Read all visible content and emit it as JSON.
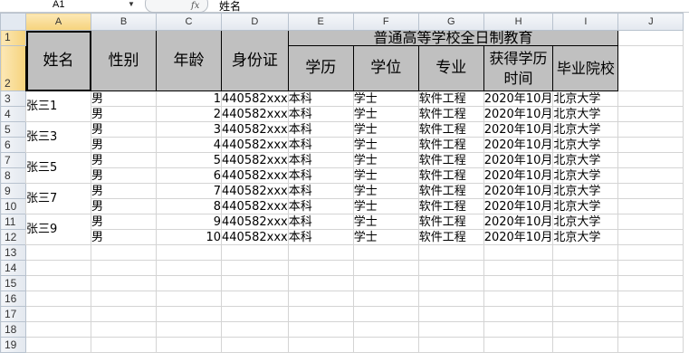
{
  "formula_bar": {
    "name_box": "A1",
    "fx_icon": "fx",
    "content": "姓名"
  },
  "columns": [
    "A",
    "B",
    "C",
    "D",
    "E",
    "F",
    "G",
    "H",
    "I",
    "J"
  ],
  "row_numbers": [
    "1",
    "2",
    "3",
    "4",
    "5",
    "6",
    "7",
    "8",
    "9",
    "10",
    "11",
    "12",
    "13",
    "14",
    "15",
    "16",
    "17",
    "18",
    "19"
  ],
  "header": {
    "name": "姓名",
    "gender": "性别",
    "age": "年龄",
    "id": "身份证",
    "banner": "普通高等学校全日制教育",
    "education": "学历",
    "degree": "学位",
    "major": "专业",
    "acquire_time": "获得学历时间",
    "school": "毕业院校"
  },
  "merged_names": [
    "张三1",
    "张三3",
    "张三5",
    "张三7",
    "张三9"
  ],
  "rows": [
    {
      "gender": "男",
      "age": "1",
      "id": "440582xxx",
      "edu": "本科",
      "degree": "学士",
      "major": "软件工程",
      "time": "2020年10月",
      "school": "北京大学"
    },
    {
      "gender": "男",
      "age": "2",
      "id": "440582xxx",
      "edu": "本科",
      "degree": "学士",
      "major": "软件工程",
      "time": "2020年10月",
      "school": "北京大学"
    },
    {
      "gender": "男",
      "age": "3",
      "id": "440582xxx",
      "edu": "本科",
      "degree": "学士",
      "major": "软件工程",
      "time": "2020年10月",
      "school": "北京大学"
    },
    {
      "gender": "男",
      "age": "4",
      "id": "440582xxx",
      "edu": "本科",
      "degree": "学士",
      "major": "软件工程",
      "time": "2020年10月",
      "school": "北京大学"
    },
    {
      "gender": "男",
      "age": "5",
      "id": "440582xxx",
      "edu": "本科",
      "degree": "学士",
      "major": "软件工程",
      "time": "2020年10月",
      "school": "北京大学"
    },
    {
      "gender": "男",
      "age": "6",
      "id": "440582xxx",
      "edu": "本科",
      "degree": "学士",
      "major": "软件工程",
      "time": "2020年10月",
      "school": "北京大学"
    },
    {
      "gender": "男",
      "age": "7",
      "id": "440582xxx",
      "edu": "本科",
      "degree": "学士",
      "major": "软件工程",
      "time": "2020年10月",
      "school": "北京大学"
    },
    {
      "gender": "男",
      "age": "8",
      "id": "440582xxx",
      "edu": "本科",
      "degree": "学士",
      "major": "软件工程",
      "time": "2020年10月",
      "school": "北京大学"
    },
    {
      "gender": "男",
      "age": "9",
      "id": "440582xxx",
      "edu": "本科",
      "degree": "学士",
      "major": "软件工程",
      "time": "2020年10月",
      "school": "北京大学"
    },
    {
      "gender": "男",
      "age": "10",
      "id": "440582xxx",
      "edu": "本科",
      "degree": "学士",
      "major": "软件工程",
      "time": "2020年10月",
      "school": "北京大学"
    }
  ]
}
